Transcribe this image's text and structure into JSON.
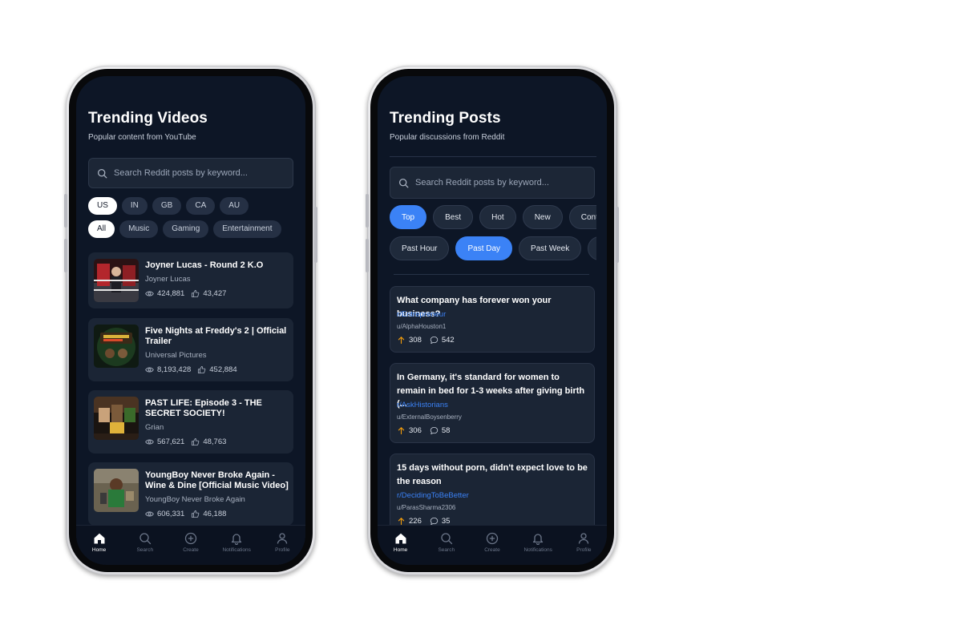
{
  "videos_screen": {
    "title": "Trending Videos",
    "subtitle": "Popular content from YouTube",
    "search_placeholder": "Search Reddit posts by keyword...",
    "regions": [
      "US",
      "IN",
      "GB",
      "CA",
      "AU"
    ],
    "selected_region": "US",
    "categories": [
      "All",
      "Music",
      "Gaming",
      "Entertainment"
    ],
    "selected_category": "All",
    "videos": [
      {
        "title": "Joyner Lucas - Round 2 K.O",
        "channel": "Joyner Lucas",
        "views": "424,881",
        "likes": "43,427"
      },
      {
        "title": "Five Nights at Freddy's 2 | Official Trailer",
        "channel": "Universal Pictures",
        "views": "8,193,428",
        "likes": "452,884"
      },
      {
        "title": "PAST LIFE: Episode 3 - THE SECRET SOCIETY!",
        "channel": "Grian",
        "views": "567,621",
        "likes": "48,763"
      },
      {
        "title": "YoungBoy Never Broke Again - Wine & Dine [Official Music Video]",
        "channel": "YoungBoy Never Broke Again",
        "views": "606,331",
        "likes": "46,188"
      }
    ]
  },
  "posts_screen": {
    "title": "Trending Posts",
    "subtitle": "Popular discussions from Reddit",
    "search_placeholder": "Search Reddit posts by keyword...",
    "sort_options": [
      "Top",
      "Best",
      "Hot",
      "New",
      "Contro"
    ],
    "selected_sort": "Top",
    "time_options": [
      "Past Hour",
      "Past Day",
      "Past Week",
      "P"
    ],
    "selected_time": "Past Day",
    "posts": [
      {
        "title": "What company has forever won your business?",
        "subreddit": "r/Entrepreneur",
        "user": "u/AlphaHouston1",
        "upvotes": "308",
        "comments": "542"
      },
      {
        "title": "In Germany, it's standard for women to remain in bed for 1-3 weeks after giving birth (...",
        "subreddit": "r/AskHistorians",
        "user": "u/ExternalBoysenberry",
        "upvotes": "306",
        "comments": "58"
      },
      {
        "title": "15 days without porn, didn't expect love to be the reason",
        "subreddit": "r/DecidingToBeBetter",
        "user": "u/ParasSharma2306",
        "upvotes": "226",
        "comments": "35"
      }
    ]
  },
  "nav": {
    "items": [
      "Home",
      "Search",
      "Create",
      "Notifications",
      "Profile"
    ],
    "active": "Home"
  },
  "colors": {
    "background": "#0d1626",
    "card": "#1b2535",
    "accent": "#3b82f6",
    "upvote": "#f59e0b"
  }
}
